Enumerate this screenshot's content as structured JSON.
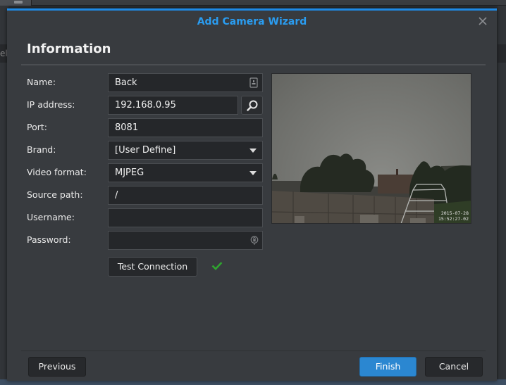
{
  "window": {
    "title": "Add Camera Wizard",
    "close_icon": "close-icon",
    "background_sidebar_partial_text": "el"
  },
  "section": {
    "title": "Information"
  },
  "form": {
    "name": {
      "label": "Name:",
      "value": "Back",
      "icon": "contact-card-icon"
    },
    "ip_address": {
      "label": "IP address:",
      "value": "192.168.0.95",
      "search_icon": "search-icon"
    },
    "port": {
      "label": "Port:",
      "value": "8081"
    },
    "brand": {
      "label": "Brand:",
      "value": "[User Define]"
    },
    "video_format": {
      "label": "Video format:",
      "value": "MJPEG"
    },
    "source_path": {
      "label": "Source path:",
      "value": "/"
    },
    "username": {
      "label": "Username:",
      "value": ""
    },
    "password": {
      "label": "Password:",
      "value": "",
      "icon": "password-lock-icon"
    }
  },
  "test_connection": {
    "label": "Test Connection",
    "status": "success",
    "status_icon": "checkmark-icon",
    "status_color": "#2fa52f"
  },
  "preview": {
    "timestamp_line1": "2015-07-28",
    "timestamp_line2": "15:52:27-02"
  },
  "footer": {
    "previous_label": "Previous",
    "finish_label": "Finish",
    "cancel_label": "Cancel"
  },
  "colors": {
    "accent": "#1e8ae6",
    "title": "#2a9cf0",
    "primary_button": "#2b87d1",
    "dialog_bg": "#383b3f",
    "field_bg": "#25272a"
  }
}
